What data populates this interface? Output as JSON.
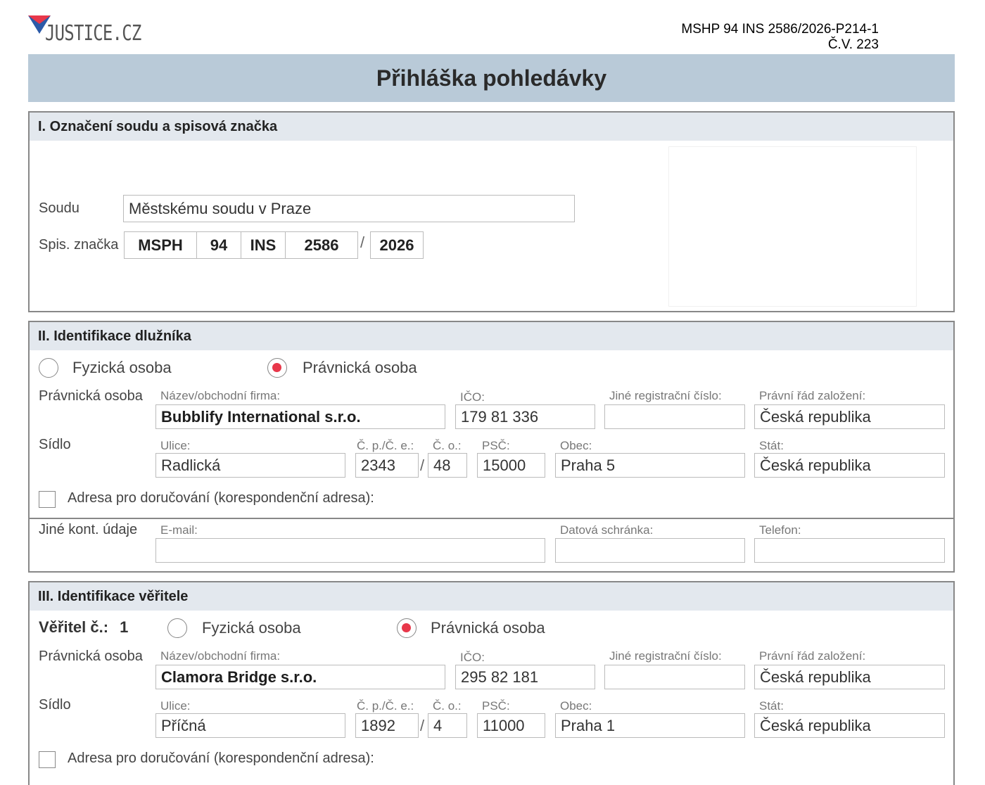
{
  "header": {
    "logo_text": "JUSTICE.CZ",
    "ref_line1": "MSHP 94 INS 2586/2026-P214-1",
    "ref_line2": "Č.V. 223",
    "title": "Přihláška pohledávky"
  },
  "section1": {
    "heading": "I. Označení soudu a spisová značka",
    "court_label": "Soudu",
    "court_value": "Městskému soudu v Praze",
    "file_label": "Spis. značka",
    "file_parts": [
      "MSPH",
      "94",
      "INS",
      "2586",
      "2026"
    ],
    "slash": "/"
  },
  "section2": {
    "heading": "II. Identifikace dlužníka",
    "radio_natural": "Fyzická osoba",
    "radio_legal": "Právnická osoba",
    "selected": "legal",
    "row_label_legal": "Právnická osoba",
    "name_label": "Název/obchodní firma:",
    "name_value": "Bubblify International s.r.o.",
    "ico_label": "IČO:",
    "ico_value": "179 81 336",
    "other_reg_label": "Jiné registrační číslo:",
    "other_reg_value": "",
    "legal_order_label": "Právní řád založení:",
    "legal_order_value": "Česká republika",
    "seat_label": "Sídlo",
    "street_label": "Ulice:",
    "street_value": "Radlická",
    "cp_label": "Č. p./Č. e.:",
    "cp_value": "2343",
    "co_label": "Č. o.:",
    "co_value": "48",
    "psc_label": "PSČ:",
    "psc_value": "15000",
    "city_label": "Obec:",
    "city_value": "Praha 5",
    "state_label": "Stát:",
    "state_value": "Česká republika",
    "delivery_label": "Adresa pro doručování (korespondenční adresa):",
    "contact_label": "Jiné kont. údaje",
    "email_label": "E-mail:",
    "email_value": "",
    "databox_label": "Datová schránka:",
    "databox_value": "",
    "phone_label": "Telefon:",
    "phone_value": ""
  },
  "section3": {
    "heading": "III. Identifikace věřitele",
    "creditor_label": "Věřitel č.:",
    "creditor_no": "1",
    "radio_natural": "Fyzická osoba",
    "radio_legal": "Právnická osoba",
    "selected": "legal",
    "row_label_legal": "Právnická osoba",
    "name_label": "Název/obchodní firma:",
    "name_value": "Clamora Bridge s.r.o.",
    "ico_label": "IČO:",
    "ico_value": "295 82 181",
    "other_reg_label": "Jiné registrační číslo:",
    "other_reg_value": "",
    "legal_order_label": "Právní řád založení:",
    "legal_order_value": "Česká republika",
    "seat_label": "Sídlo",
    "street_label": "Ulice:",
    "street_value": "Příčná",
    "cp_label": "Č. p./Č. e.:",
    "cp_value": "1892",
    "co_label": "Č. o.:",
    "co_value": "4",
    "psc_label": "PSČ:",
    "psc_value": "11000",
    "city_label": "Obec:",
    "city_value": "Praha 1",
    "state_label": "Stát:",
    "state_value": "Česká republika",
    "delivery_label": "Adresa pro doručování (korespondenční adresa):"
  },
  "colors": {
    "accent_red": "#e8374a",
    "logo_blue": "#2b5aa8",
    "title_bar": "#b9cad8"
  }
}
